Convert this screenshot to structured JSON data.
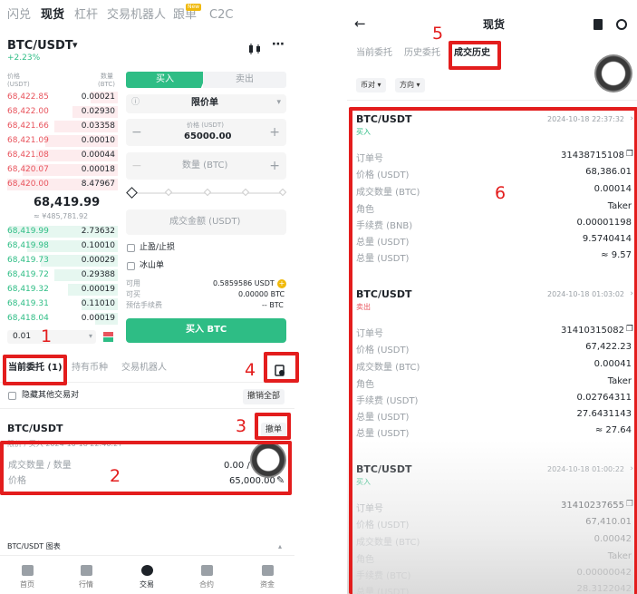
{
  "left": {
    "top_tabs": [
      "闪兑",
      "现货",
      "杠杆",
      "交易机器人",
      "跟单",
      "C2C"
    ],
    "new_badge": "New",
    "pair": "BTC/USDT",
    "pair_caret": "▾",
    "change": "+2.23%",
    "ob_head_price": "价格\n(USDT)",
    "ob_head_price_1": "价格",
    "ob_head_price_2": "(USDT)",
    "ob_head_qty_1": "数量",
    "ob_head_qty_2": "(BTC)",
    "asks": [
      {
        "price": "68,422.85",
        "qty": "0.00021"
      },
      {
        "price": "68,422.00",
        "qty": "0.02930"
      },
      {
        "price": "68,421.66",
        "qty": "0.03358"
      },
      {
        "price": "68,421.09",
        "qty": "0.00010"
      },
      {
        "price": "68,421.08",
        "qty": "0.00044"
      },
      {
        "price": "68,420.07",
        "qty": "0.00018"
      },
      {
        "price": "68,420.00",
        "qty": "8.47967"
      }
    ],
    "last_price": "68,419.99",
    "last_price_cny": "≈ ¥485,781.92",
    "bids": [
      {
        "price": "68,419.99",
        "qty": "2.73632"
      },
      {
        "price": "68,419.98",
        "qty": "0.10010"
      },
      {
        "price": "68,419.73",
        "qty": "0.00029"
      },
      {
        "price": "68,419.72",
        "qty": "0.29388"
      },
      {
        "price": "68,419.32",
        "qty": "0.00019"
      },
      {
        "price": "68,419.31",
        "qty": "0.11010"
      },
      {
        "price": "68,418.04",
        "qty": "0.00019"
      }
    ],
    "depth_value": "0.01",
    "buy_tab": "买入",
    "sell_tab": "卖出",
    "order_type": "限价单",
    "price_label": "价格 (USDT)",
    "price_value": "65000.00",
    "qty_placeholder": "数量 (BTC)",
    "amount_placeholder": "成交金额 (USDT)",
    "tp_sl": "止盈/止损",
    "iceberg": "冰山单",
    "available_label": "可用",
    "available_value": "0.5859586 USDT",
    "can_buy_label": "可买",
    "can_buy_value": "0.00000 BTC",
    "fee_label": "预估手续费",
    "fee_value": "-- BTC",
    "buy_button": "买入 BTC",
    "order_tabs": [
      "当前委托 (1)",
      "持有币种",
      "交易机器人"
    ],
    "hide_other": "隐藏其他交易对",
    "cancel_all": "撤销全部",
    "order_pair": "BTC/USDT",
    "cancel_one": "撤单",
    "order_meta": "限价 / 买入  2024-10-18 22:40:27",
    "filled_label": "成交数量 / 数量",
    "filled_value": "0.00 /",
    "order_price_label": "价格",
    "order_price_value": "65,000.00",
    "chart_label": "BTC/USDT 图表",
    "nav": [
      "首页",
      "行情",
      "交易",
      "合约",
      "资金"
    ]
  },
  "right": {
    "title": "现货",
    "tabs": [
      "当前委托",
      "历史委托",
      "成交历史"
    ],
    "filters": [
      "币对",
      "方向"
    ],
    "trades": [
      {
        "pair": "BTC/USDT",
        "side": "买入",
        "time": "2024-10-18 22:37:32",
        "rows": [
          [
            "订单号",
            "31438715108"
          ],
          [
            "价格 (USDT)",
            "68,386.01"
          ],
          [
            "成交数量 (BTC)",
            "0.00014"
          ],
          [
            "角色",
            "Taker"
          ],
          [
            "手续费 (BNB)",
            "0.00001198"
          ],
          [
            "总量 (USDT)",
            "9.5740414"
          ],
          [
            "总量 (USDT)",
            "≈ 9.57"
          ]
        ]
      },
      {
        "pair": "BTC/USDT",
        "side": "卖出",
        "time": "2024-10-18 01:03:02",
        "rows": [
          [
            "订单号",
            "31410315082"
          ],
          [
            "价格 (USDT)",
            "67,422.23"
          ],
          [
            "成交数量 (BTC)",
            "0.00041"
          ],
          [
            "角色",
            "Taker"
          ],
          [
            "手续费 (USDT)",
            "0.02764311"
          ],
          [
            "总量 (USDT)",
            "27.6431143"
          ],
          [
            "总量 (USDT)",
            "≈ 27.64"
          ]
        ]
      },
      {
        "pair": "BTC/USDT",
        "side": "买入",
        "time": "2024-10-18 01:00:22",
        "rows": [
          [
            "订单号",
            "31410237655"
          ],
          [
            "价格 (USDT)",
            "67,410.01"
          ],
          [
            "成交数量 (BTC)",
            "0.00042"
          ],
          [
            "角色",
            "Taker"
          ],
          [
            "手续费 (BTC)",
            "0.00000042"
          ],
          [
            "总量 (USDT)",
            "28.3122042"
          ]
        ]
      }
    ]
  },
  "annotations": [
    "1",
    "2",
    "3",
    "4",
    "5",
    "6"
  ],
  "colors": {
    "ask": "#e8545d",
    "bid": "#2ebd85",
    "accent": "#2ebd85",
    "highlight": "#e31d1d"
  }
}
